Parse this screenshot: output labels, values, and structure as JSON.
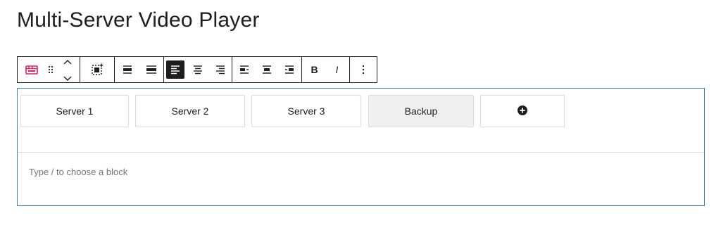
{
  "page": {
    "title": "Multi-Server Video Player"
  },
  "toolbar": {
    "bold_label": "B",
    "italic_label": "I",
    "icons": [
      "video-block-icon",
      "drag-handle-icon",
      "move-up-icon",
      "move-down-icon",
      "select-parent-icon",
      "align-wide-icon",
      "align-full-icon",
      "align-left-icon",
      "align-center-icon",
      "align-right-icon",
      "justify-left-icon",
      "justify-center-icon",
      "justify-right-icon",
      "more-options-icon"
    ],
    "accent_color": "#e0235f"
  },
  "servers": {
    "items": [
      {
        "label": "Server 1"
      },
      {
        "label": "Server 2"
      },
      {
        "label": "Server 3"
      },
      {
        "label": "Backup",
        "selected": true
      }
    ],
    "add_icon": "plus-circle-icon"
  },
  "editor": {
    "placeholder": "Type / to choose a block"
  },
  "colors": {
    "block_border": "#3c8ab8",
    "selected_bg": "#f0f0f0",
    "text": "#1e1e1e",
    "muted": "#757575"
  }
}
